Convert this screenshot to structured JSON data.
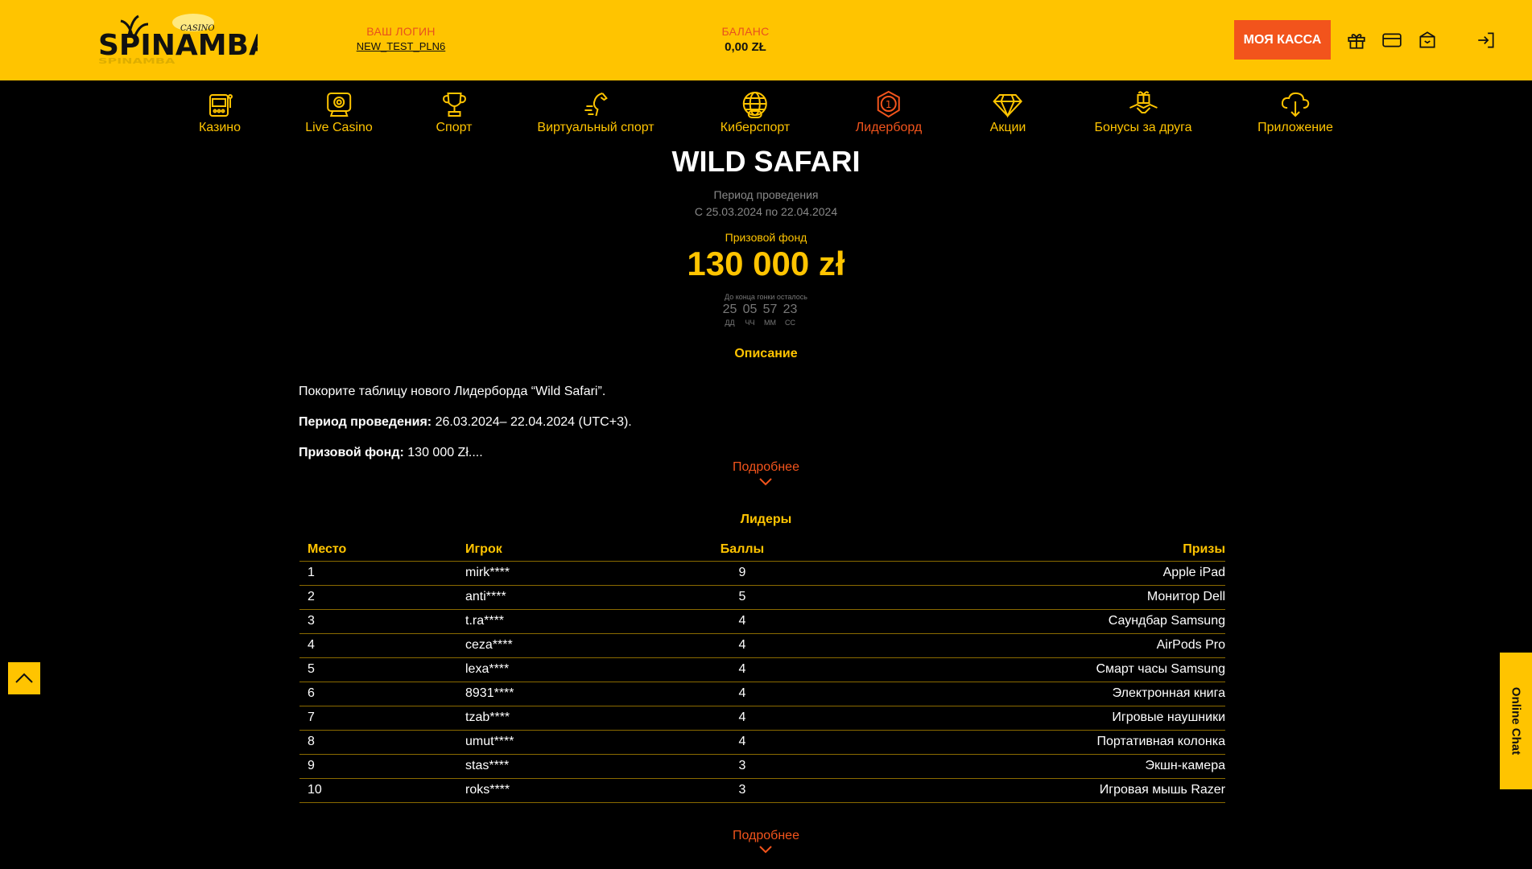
{
  "header": {
    "logo_text": "SPINAMBA",
    "logo_sub": "CASINO",
    "login_label": "ВАШ ЛОГИН",
    "login_value": "NEW_TEST_PLN6",
    "balance_label": "БАЛАНС",
    "balance_value": "0,00 ZŁ",
    "cashier_label": "МОЯ КАССА",
    "icons": [
      "gift-icon",
      "card-icon",
      "inbox-icon",
      "logout-icon"
    ]
  },
  "nav": {
    "items": [
      {
        "label": "Казино",
        "icon": "slot-machine-icon"
      },
      {
        "label": "Live Casino",
        "icon": "webcam-icon"
      },
      {
        "label": "Спорт",
        "icon": "trophy-icon"
      },
      {
        "label": "Виртуальный спорт",
        "icon": "horse-icon"
      },
      {
        "label": "Киберспорт",
        "icon": "globe-gamepad-icon"
      },
      {
        "label": "Лидерборд",
        "icon": "leaderboard-badge-icon",
        "active": true,
        "badge": "1"
      },
      {
        "label": "Акции",
        "icon": "diamond-icon"
      },
      {
        "label": "Бонусы за друга",
        "icon": "gift-handshake-icon"
      },
      {
        "label": "Приложение",
        "icon": "cloud-download-icon"
      }
    ]
  },
  "tournament": {
    "title": "WILD SAFARI",
    "period_label": "Период проведения",
    "period_dates": "С 25.03.2024 по 22.04.2024",
    "prize_label": "Призовой фонд",
    "prize_value": "130 000 zł",
    "countdown_label": "До конца гонки осталось",
    "countdown": [
      {
        "value": "25",
        "unit": "ДД"
      },
      {
        "value": "05",
        "unit": "ЧЧ"
      },
      {
        "value": "57",
        "unit": "ММ"
      },
      {
        "value": "23",
        "unit": "СС"
      }
    ]
  },
  "description": {
    "heading": "Описание",
    "line1": "Покорите таблицу нового Лидерборда “Wild Safari”.",
    "line2_bold": "Период проведения:",
    "line2_text": " 26.03.2024– 22.04.2024 (UTC+3).",
    "line3_bold": "Призовой фонд:",
    "line3_text": " 130 000 Zł....",
    "more": "Подробнее"
  },
  "leaders": {
    "heading": "Лидеры",
    "columns": {
      "place": "Место",
      "player": "Игрок",
      "score": "Баллы",
      "prize": "Призы"
    },
    "rows": [
      {
        "place": "1",
        "player": "mirk****",
        "score": "9",
        "prize": "Apple iPad"
      },
      {
        "place": "2",
        "player": "anti****",
        "score": "5",
        "prize": "Монитор Dell"
      },
      {
        "place": "3",
        "player": "t.ra****",
        "score": "4",
        "prize": "Саундбар Samsung"
      },
      {
        "place": "4",
        "player": "ceza****",
        "score": "4",
        "prize": "AirPods Pro"
      },
      {
        "place": "5",
        "player": "lexa****",
        "score": "4",
        "prize": "Смарт часы Samsung"
      },
      {
        "place": "6",
        "player": "8931****",
        "score": "4",
        "prize": "Электронная книга"
      },
      {
        "place": "7",
        "player": "tzab****",
        "score": "4",
        "prize": "Игровые наушники"
      },
      {
        "place": "8",
        "player": "umut****",
        "score": "4",
        "prize": "Портативная колонка"
      },
      {
        "place": "9",
        "player": "stas****",
        "score": "3",
        "prize": "Экшн-камера"
      },
      {
        "place": "10",
        "player": "roks****",
        "score": "3",
        "prize": "Игровая мышь Razer"
      }
    ],
    "more": "Подробнее"
  },
  "widgets": {
    "online_chat": "Online Chat",
    "scroll_top_icon": "chevron-up-icon"
  },
  "colors": {
    "brand_yellow": "#ffc400",
    "accent_orange": "#f2541c",
    "background": "#000000"
  }
}
